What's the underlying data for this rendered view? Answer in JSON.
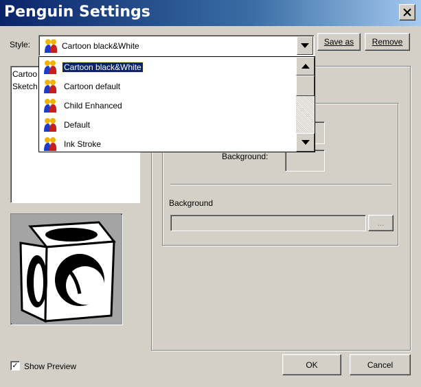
{
  "window": {
    "title": "Penguin Settings"
  },
  "style_row": {
    "label": "Style:",
    "selected_value": "Cartoon black&White",
    "save_as_label": "Save as",
    "remove_label": "Remove"
  },
  "dropdown": {
    "options": [
      {
        "label": "Cartoon black&White",
        "selected": true
      },
      {
        "label": "Cartoon default"
      },
      {
        "label": "Child Enhanced"
      },
      {
        "label": "Default"
      },
      {
        "label": "Ink Stroke"
      }
    ]
  },
  "style_list": {
    "items": [
      "Cartoo",
      "Sketch"
    ]
  },
  "right_panel": {
    "background_color_label": "Background:",
    "background_group_label": "Background",
    "browse_label": "..."
  },
  "footer": {
    "show_preview_label": "Show Preview",
    "show_preview_checked": true,
    "check_mark": "✓",
    "ok_label": "OK",
    "cancel_label": "Cancel"
  },
  "icons": [
    "close-icon",
    "dropdown-arrow-icon",
    "penguin-style-icon",
    "scroll-up-icon",
    "scroll-down-icon"
  ]
}
